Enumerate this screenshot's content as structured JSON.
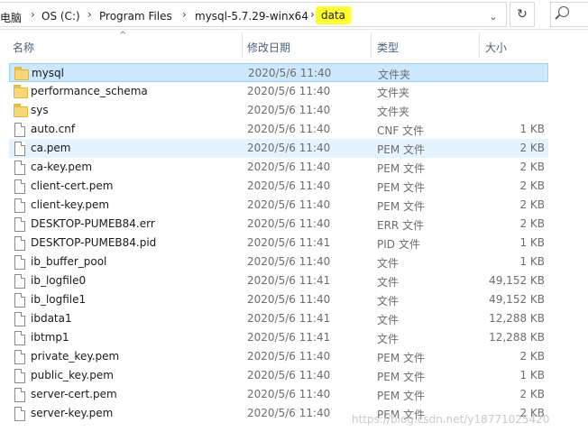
{
  "address": {
    "breadcrumbs": [
      "电脑",
      "OS (C:)",
      "Program Files",
      "mysql-5.7.29-winx64",
      "data"
    ],
    "highlight_color": "#ffff33"
  },
  "columns": {
    "name": "名称",
    "date": "修改日期",
    "type": "类型",
    "size": "大小"
  },
  "rows": [
    {
      "name": "mysql",
      "date": "2020/5/6 11:40",
      "type": "文件夹",
      "size": "",
      "icon": "folder-icon",
      "state": "selected"
    },
    {
      "name": "performance_schema",
      "date": "2020/5/6 11:40",
      "type": "文件夹",
      "size": "",
      "icon": "folder-icon",
      "state": ""
    },
    {
      "name": "sys",
      "date": "2020/5/6 11:40",
      "type": "文件夹",
      "size": "",
      "icon": "folder-icon",
      "state": ""
    },
    {
      "name": "auto.cnf",
      "date": "2020/5/6 11:40",
      "type": "CNF 文件",
      "size": "1 KB",
      "icon": "file-icon",
      "state": ""
    },
    {
      "name": "ca.pem",
      "date": "2020/5/6 11:40",
      "type": "PEM 文件",
      "size": "2 KB",
      "icon": "file-icon",
      "state": "hover"
    },
    {
      "name": "ca-key.pem",
      "date": "2020/5/6 11:40",
      "type": "PEM 文件",
      "size": "2 KB",
      "icon": "file-icon",
      "state": ""
    },
    {
      "name": "client-cert.pem",
      "date": "2020/5/6 11:40",
      "type": "PEM 文件",
      "size": "2 KB",
      "icon": "file-icon",
      "state": ""
    },
    {
      "name": "client-key.pem",
      "date": "2020/5/6 11:40",
      "type": "PEM 文件",
      "size": "2 KB",
      "icon": "file-icon",
      "state": ""
    },
    {
      "name": "DESKTOP-PUMEB84.err",
      "date": "2020/5/6 11:40",
      "type": "ERR 文件",
      "size": "2 KB",
      "icon": "file-icon",
      "state": ""
    },
    {
      "name": "DESKTOP-PUMEB84.pid",
      "date": "2020/5/6 11:41",
      "type": "PID 文件",
      "size": "1 KB",
      "icon": "file-icon",
      "state": ""
    },
    {
      "name": "ib_buffer_pool",
      "date": "2020/5/6 11:40",
      "type": "文件",
      "size": "1 KB",
      "icon": "file-icon",
      "state": ""
    },
    {
      "name": "ib_logfile0",
      "date": "2020/5/6 11:41",
      "type": "文件",
      "size": "49,152 KB",
      "icon": "file-icon",
      "state": ""
    },
    {
      "name": "ib_logfile1",
      "date": "2020/5/6 11:40",
      "type": "文件",
      "size": "49,152 KB",
      "icon": "file-icon",
      "state": ""
    },
    {
      "name": "ibdata1",
      "date": "2020/5/6 11:41",
      "type": "文件",
      "size": "12,288 KB",
      "icon": "file-icon",
      "state": ""
    },
    {
      "name": "ibtmp1",
      "date": "2020/5/6 11:41",
      "type": "文件",
      "size": "12,288 KB",
      "icon": "file-icon",
      "state": ""
    },
    {
      "name": "private_key.pem",
      "date": "2020/5/6 11:40",
      "type": "PEM 文件",
      "size": "2 KB",
      "icon": "file-icon",
      "state": ""
    },
    {
      "name": "public_key.pem",
      "date": "2020/5/6 11:40",
      "type": "PEM 文件",
      "size": "1 KB",
      "icon": "file-icon",
      "state": ""
    },
    {
      "name": "server-cert.pem",
      "date": "2020/5/6 11:40",
      "type": "PEM 文件",
      "size": "2 KB",
      "icon": "file-icon",
      "state": ""
    },
    {
      "name": "server-key.pem",
      "date": "2020/5/6 11:40",
      "type": "PEM 文件",
      "size": "2 KB",
      "icon": "file-icon",
      "state": ""
    }
  ],
  "watermark": "https://blog.csdn.net/y18771025420"
}
